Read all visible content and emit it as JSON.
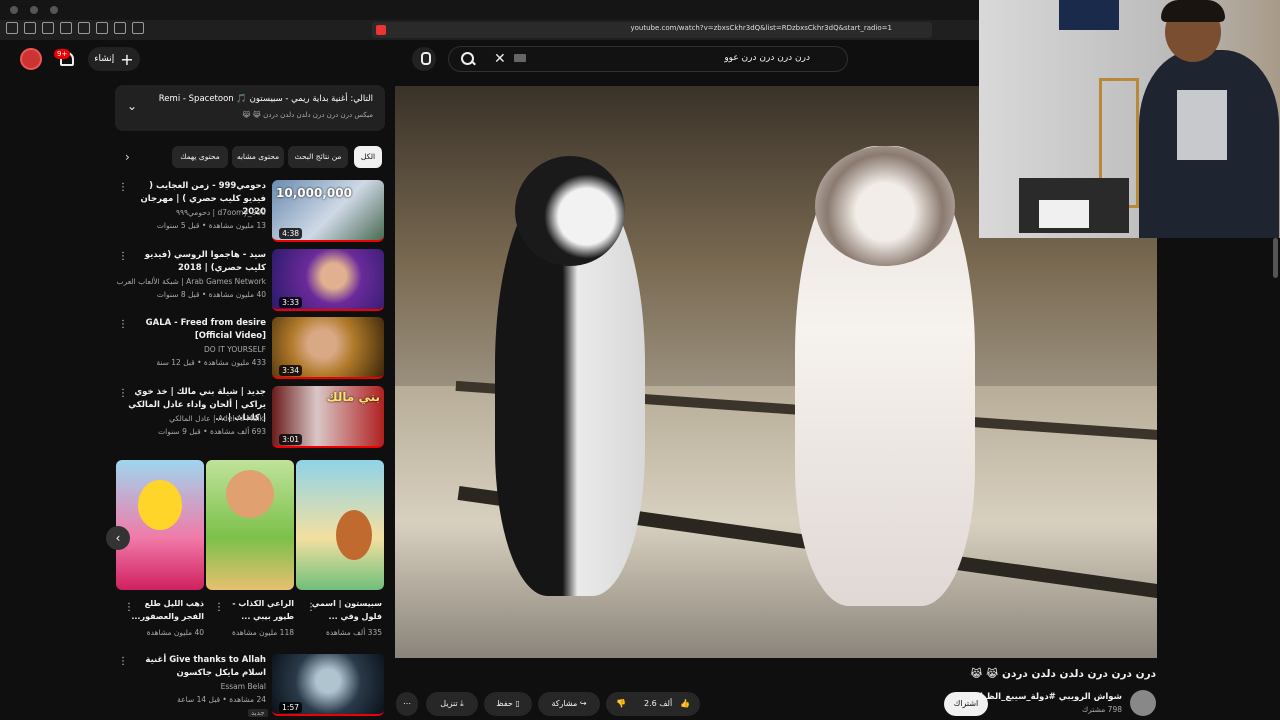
{
  "browser": {
    "url": "youtube.com/watch?v=zbxsCkhr3dQ&list=RDzbxsCkhr3dQ&start_radio=1"
  },
  "header": {
    "create_label": "إنشاء",
    "notification_count": "9+",
    "search_query": "درن درن درن درن عوو"
  },
  "up_next": {
    "title": "التالي: أغنية بداية ريمي - سبيستون 🎵 Remi - Spacetoon",
    "subtitle": "ميكس درن درن درن دلدن دلدن دردن 😹 😹"
  },
  "chips": [
    "الكل",
    "من نتائج البحث",
    "محتوى مشابه",
    "محتوى يهمك"
  ],
  "recommendations": [
    {
      "title": "دحومي999 - زمن العجايب ( فيديو كليب حصري ) | مهرجان 2020",
      "channel": "d7oomy_999 | دحومي٩٩٩",
      "meta": "13 مليون مشاهدة • قبل 5 سنوات",
      "duration": "4:38",
      "thumb_text": "10,000,000"
    },
    {
      "title": "سيد - هاجموا الروسي (فيديو كليب حصري) | 2018",
      "channel": "Arab Games Network | شبكة الألعاب العرب",
      "meta": "40 مليون مشاهدة • قبل 8 سنوات",
      "duration": "3:33",
      "thumb_text": ""
    },
    {
      "title": "GALA - Freed from desire [Official Video]",
      "channel": "DO IT YOURSELF",
      "meta": "433 مليون مشاهدة • قبل 12 سنة",
      "duration": "3:34",
      "thumb_text": ""
    },
    {
      "title": "جديد | شيلة بني مالك | خذ خوي يراكي | ألحان واداء عادل المالكي | كلمات | ...",
      "channel": "Adel Al Malki | عادل المالكي",
      "meta": "693 ألف مشاهدة • قبل 9 سنوات",
      "duration": "3:01",
      "thumb_text": "بني مالك"
    }
  ],
  "shelf": [
    {
      "title": "سبيستون | اسمي فلول وفي ...",
      "meta": "335 ألف مشاهدة"
    },
    {
      "title": "الراعي الكذاب - طيور بيبي ...",
      "meta": "118 مليون مشاهدة"
    },
    {
      "title": "ذهب الليل طلع الفجر والعصفور...",
      "meta": "40 مليون مشاهدة"
    }
  ],
  "last_rec": {
    "title": "Give thanks to Allah أغنية اسلام مايكل جاكسون",
    "channel": "Essam Belal",
    "meta": "24 مشاهدة • قبل 14 ساعة",
    "duration": "1:57",
    "badge": "جديد"
  },
  "video": {
    "title": "درن درن درن دلدن دلدن دردن 😹 😹",
    "channel_name": "شواش الرويبي #دولة_سيبع_الظباء",
    "channel_subs": "798 مشترك",
    "subscribe_label": "اشتراك",
    "like_count": "2.6 ألف",
    "share_label": "مشاركة",
    "save_label": "حفظ",
    "download_label": "تنزيل"
  }
}
